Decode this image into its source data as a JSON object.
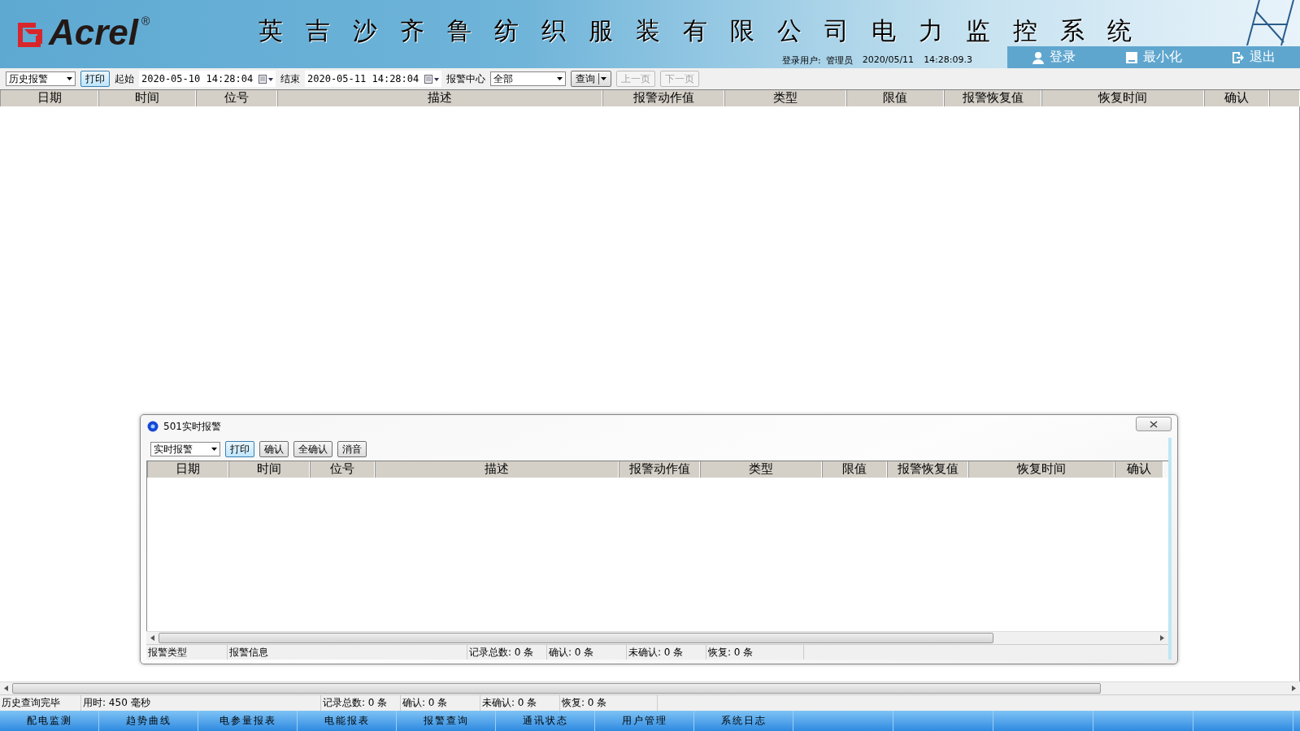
{
  "header": {
    "logo": "Acrel",
    "logo_mark": "®",
    "title": "英吉沙齐鲁纺织服装有限公司电力监控系统",
    "user_label": "登录用户:",
    "user": "管理员",
    "date": "2020/05/11",
    "time": "14:28:09.3",
    "actions": [
      {
        "kind": "login",
        "label": "登录"
      },
      {
        "kind": "minimize",
        "label": "最小化"
      },
      {
        "kind": "exit",
        "label": "退出"
      }
    ]
  },
  "toolbar": {
    "mode": "历史报警",
    "print": "打印",
    "start_label": "起始",
    "start": "2020-05-10 14:28:04",
    "end_label": "结束",
    "end": "2020-05-11 14:28:04",
    "center_label": "报警中心",
    "center": "全部",
    "query": "查询",
    "pager": [
      {
        "label": "上一页",
        "disabled": true
      },
      {
        "label": "下一页",
        "disabled": true
      }
    ]
  },
  "table": {
    "columns": [
      "日期",
      "时间",
      "位号",
      "描述",
      "报警动作值",
      "类型",
      "限值",
      "报警恢复值",
      "恢复时间",
      "确认",
      ""
    ]
  },
  "status_bar": [
    "历史查询完毕",
    "用时: 450 毫秒",
    "记录总数: 0 条",
    "确认: 0 条",
    "未确认: 0 条",
    "恢复: 0 条"
  ],
  "nav": [
    "配电监测",
    "趋势曲线",
    "电参量报表",
    "电能报表",
    "报警查询",
    "通讯状态",
    "用户管理",
    "系统日志"
  ],
  "dialog": {
    "title": "501实时报警",
    "mode": "实时报警",
    "buttons": [
      "打印",
      "确认",
      "全确认",
      "消音"
    ],
    "columns": [
      "日期",
      "时间",
      "位号",
      "描述",
      "报警动作值",
      "类型",
      "限值",
      "报警恢复值",
      "恢复时间",
      "确认"
    ],
    "status_bar": [
      "报警类型",
      "报警信息",
      "记录总数: 0 条",
      "确认: 0 条",
      "未确认: 0 条",
      "恢复: 0 条"
    ]
  }
}
